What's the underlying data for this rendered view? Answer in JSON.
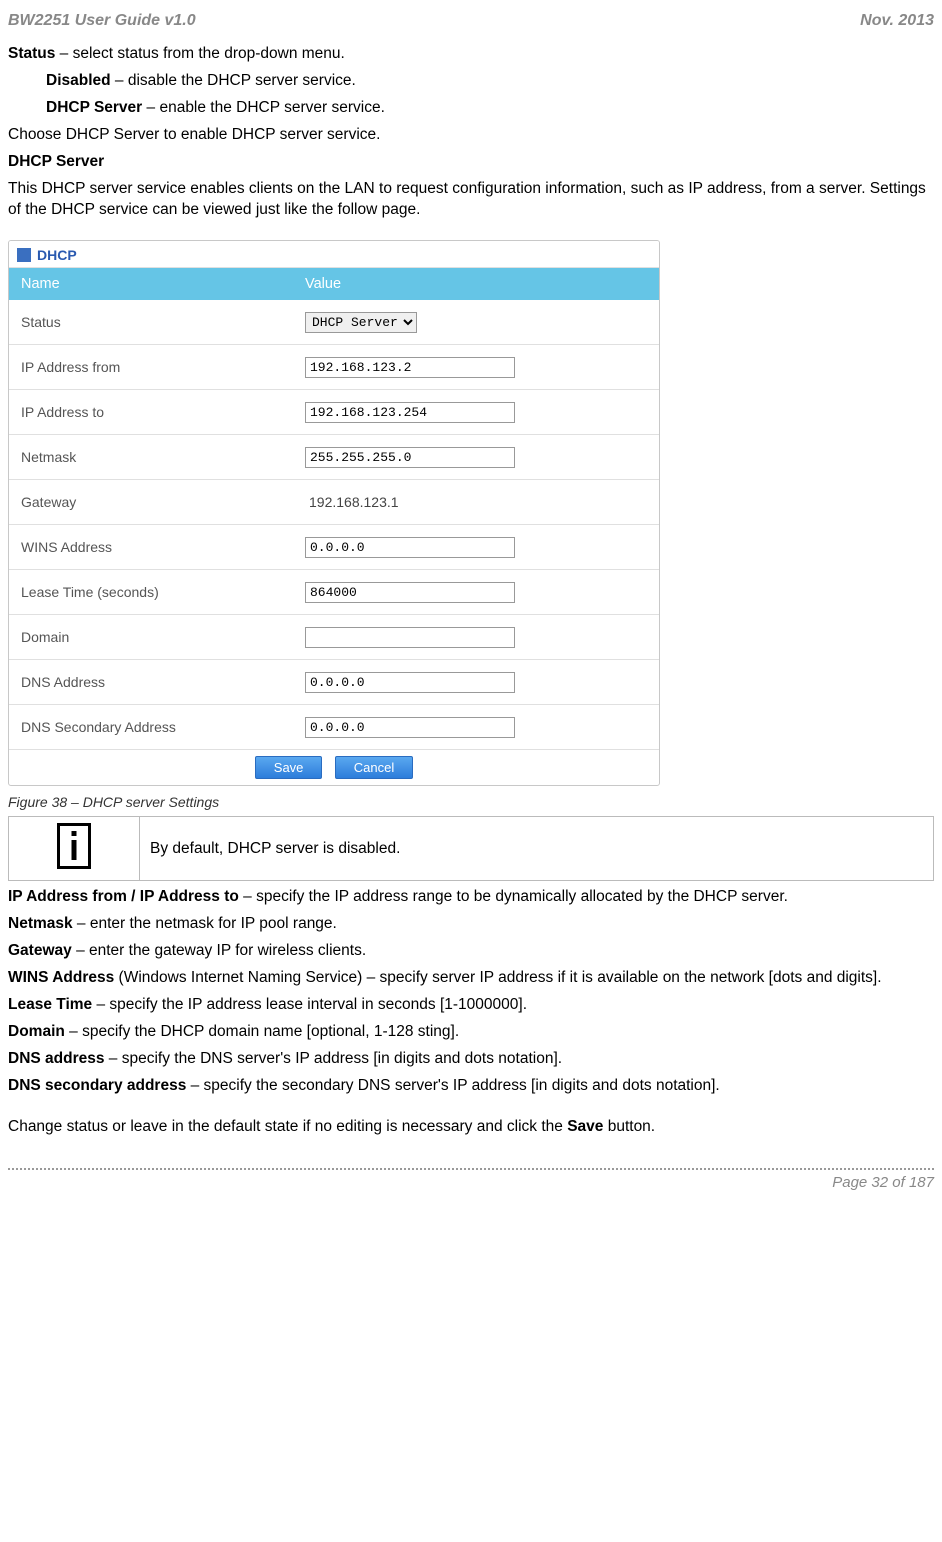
{
  "header": {
    "left": "BW2251 User Guide v1.0",
    "right": "Nov.  2013"
  },
  "body": {
    "p1_b": "Status",
    "p1_r": " – select status from the drop-down menu.",
    "p2_b": "Disabled",
    "p2_r": " – disable the DHCP server service.",
    "p3_b": "DHCP Server",
    "p3_r": " – enable the DHCP server service.",
    "p4": "Choose DHCP Server to enable DHCP server service.",
    "p5_b": "DHCP Server",
    "p6": "This DHCP server service enables clients on the LAN to request configuration information, such as IP address, from a server. Settings of the DHCP service can be viewed just like the follow page."
  },
  "panel": {
    "title": "DHCP",
    "hdr_name": "Name",
    "hdr_value": "Value",
    "rows": {
      "status_label": "Status",
      "status_value": "DHCP Server",
      "ipfrom_label": "IP Address from",
      "ipfrom_value": "192.168.123.2",
      "ipto_label": "IP Address to",
      "ipto_value": "192.168.123.254",
      "netmask_label": "Netmask",
      "netmask_value": "255.255.255.0",
      "gateway_label": "Gateway",
      "gateway_value": "192.168.123.1",
      "wins_label": "WINS Address",
      "wins_value": "0.0.0.0",
      "lease_label": "Lease Time (seconds)",
      "lease_value": "864000",
      "domain_label": "Domain",
      "domain_value": "",
      "dns_label": "DNS Address",
      "dns_value": "0.0.0.0",
      "dns2_label": "DNS Secondary Address",
      "dns2_value": "0.0.0.0"
    },
    "save": "Save",
    "cancel": "Cancel"
  },
  "caption": "Figure 38 – DHCP server Settings",
  "note": "By default, DHCP server is disabled.",
  "defs": {
    "d1_b": "IP Address from / IP Address to",
    "d1_r": " – specify the IP address range to be dynamically allocated by the DHCP server.",
    "d2_b": "Netmask",
    "d2_r": " – enter the netmask for IP pool range.",
    "d3_b": "Gateway",
    "d3_r": " – enter the gateway IP for wireless clients.",
    "d4_b": "WINS Address",
    "d4_r": " (Windows Internet Naming Service) – specify server IP address if it is available on the network [dots and digits].",
    "d5_b": "Lease Time",
    "d5_r": " – specify the IP address lease interval in seconds [1-1000000].",
    "d6_b": "Domain",
    "d6_r": " – specify the DHCP domain name [optional, 1-128 sting].",
    "d7_b": "DNS address",
    "d7_r": " – specify the DNS server's IP address [in digits and dots notation].",
    "d8_b": "DNS secondary address",
    "d8_r": " – specify the secondary DNS server's IP address [in digits and dots notation].",
    "d9_a": "Change status or leave in the default state if no editing is necessary and click the ",
    "d9_b": "Save",
    "d9_c": " button."
  },
  "footer": "Page 32 of 187"
}
